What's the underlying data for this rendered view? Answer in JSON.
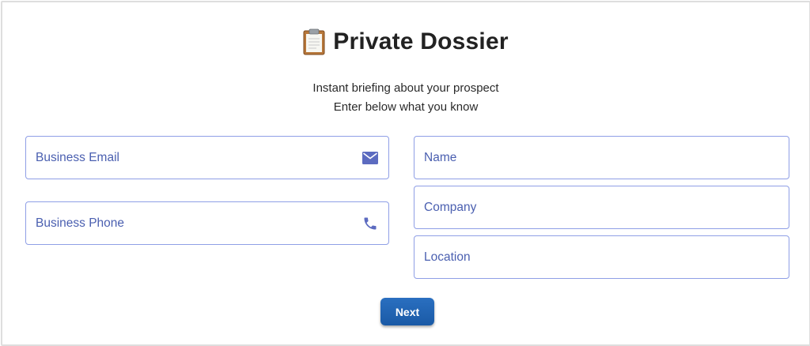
{
  "header": {
    "title": "Private Dossier",
    "title_icon": "clipboard-icon",
    "subtitle_line1": "Instant briefing about your prospect",
    "subtitle_line2": "Enter below what you know"
  },
  "form": {
    "email": {
      "placeholder": "Business Email",
      "icon": "envelope-icon"
    },
    "phone": {
      "placeholder": "Business Phone",
      "icon": "phone-icon"
    },
    "name": {
      "placeholder": "Name"
    },
    "company": {
      "placeholder": "Company"
    },
    "location": {
      "placeholder": "Location"
    },
    "next_label": "Next"
  },
  "colors": {
    "field_border": "#8f9fe6",
    "placeholder": "#4a5fb0",
    "icon": "#5c6bc0",
    "button": "#1e63b3",
    "title": "#222222"
  }
}
